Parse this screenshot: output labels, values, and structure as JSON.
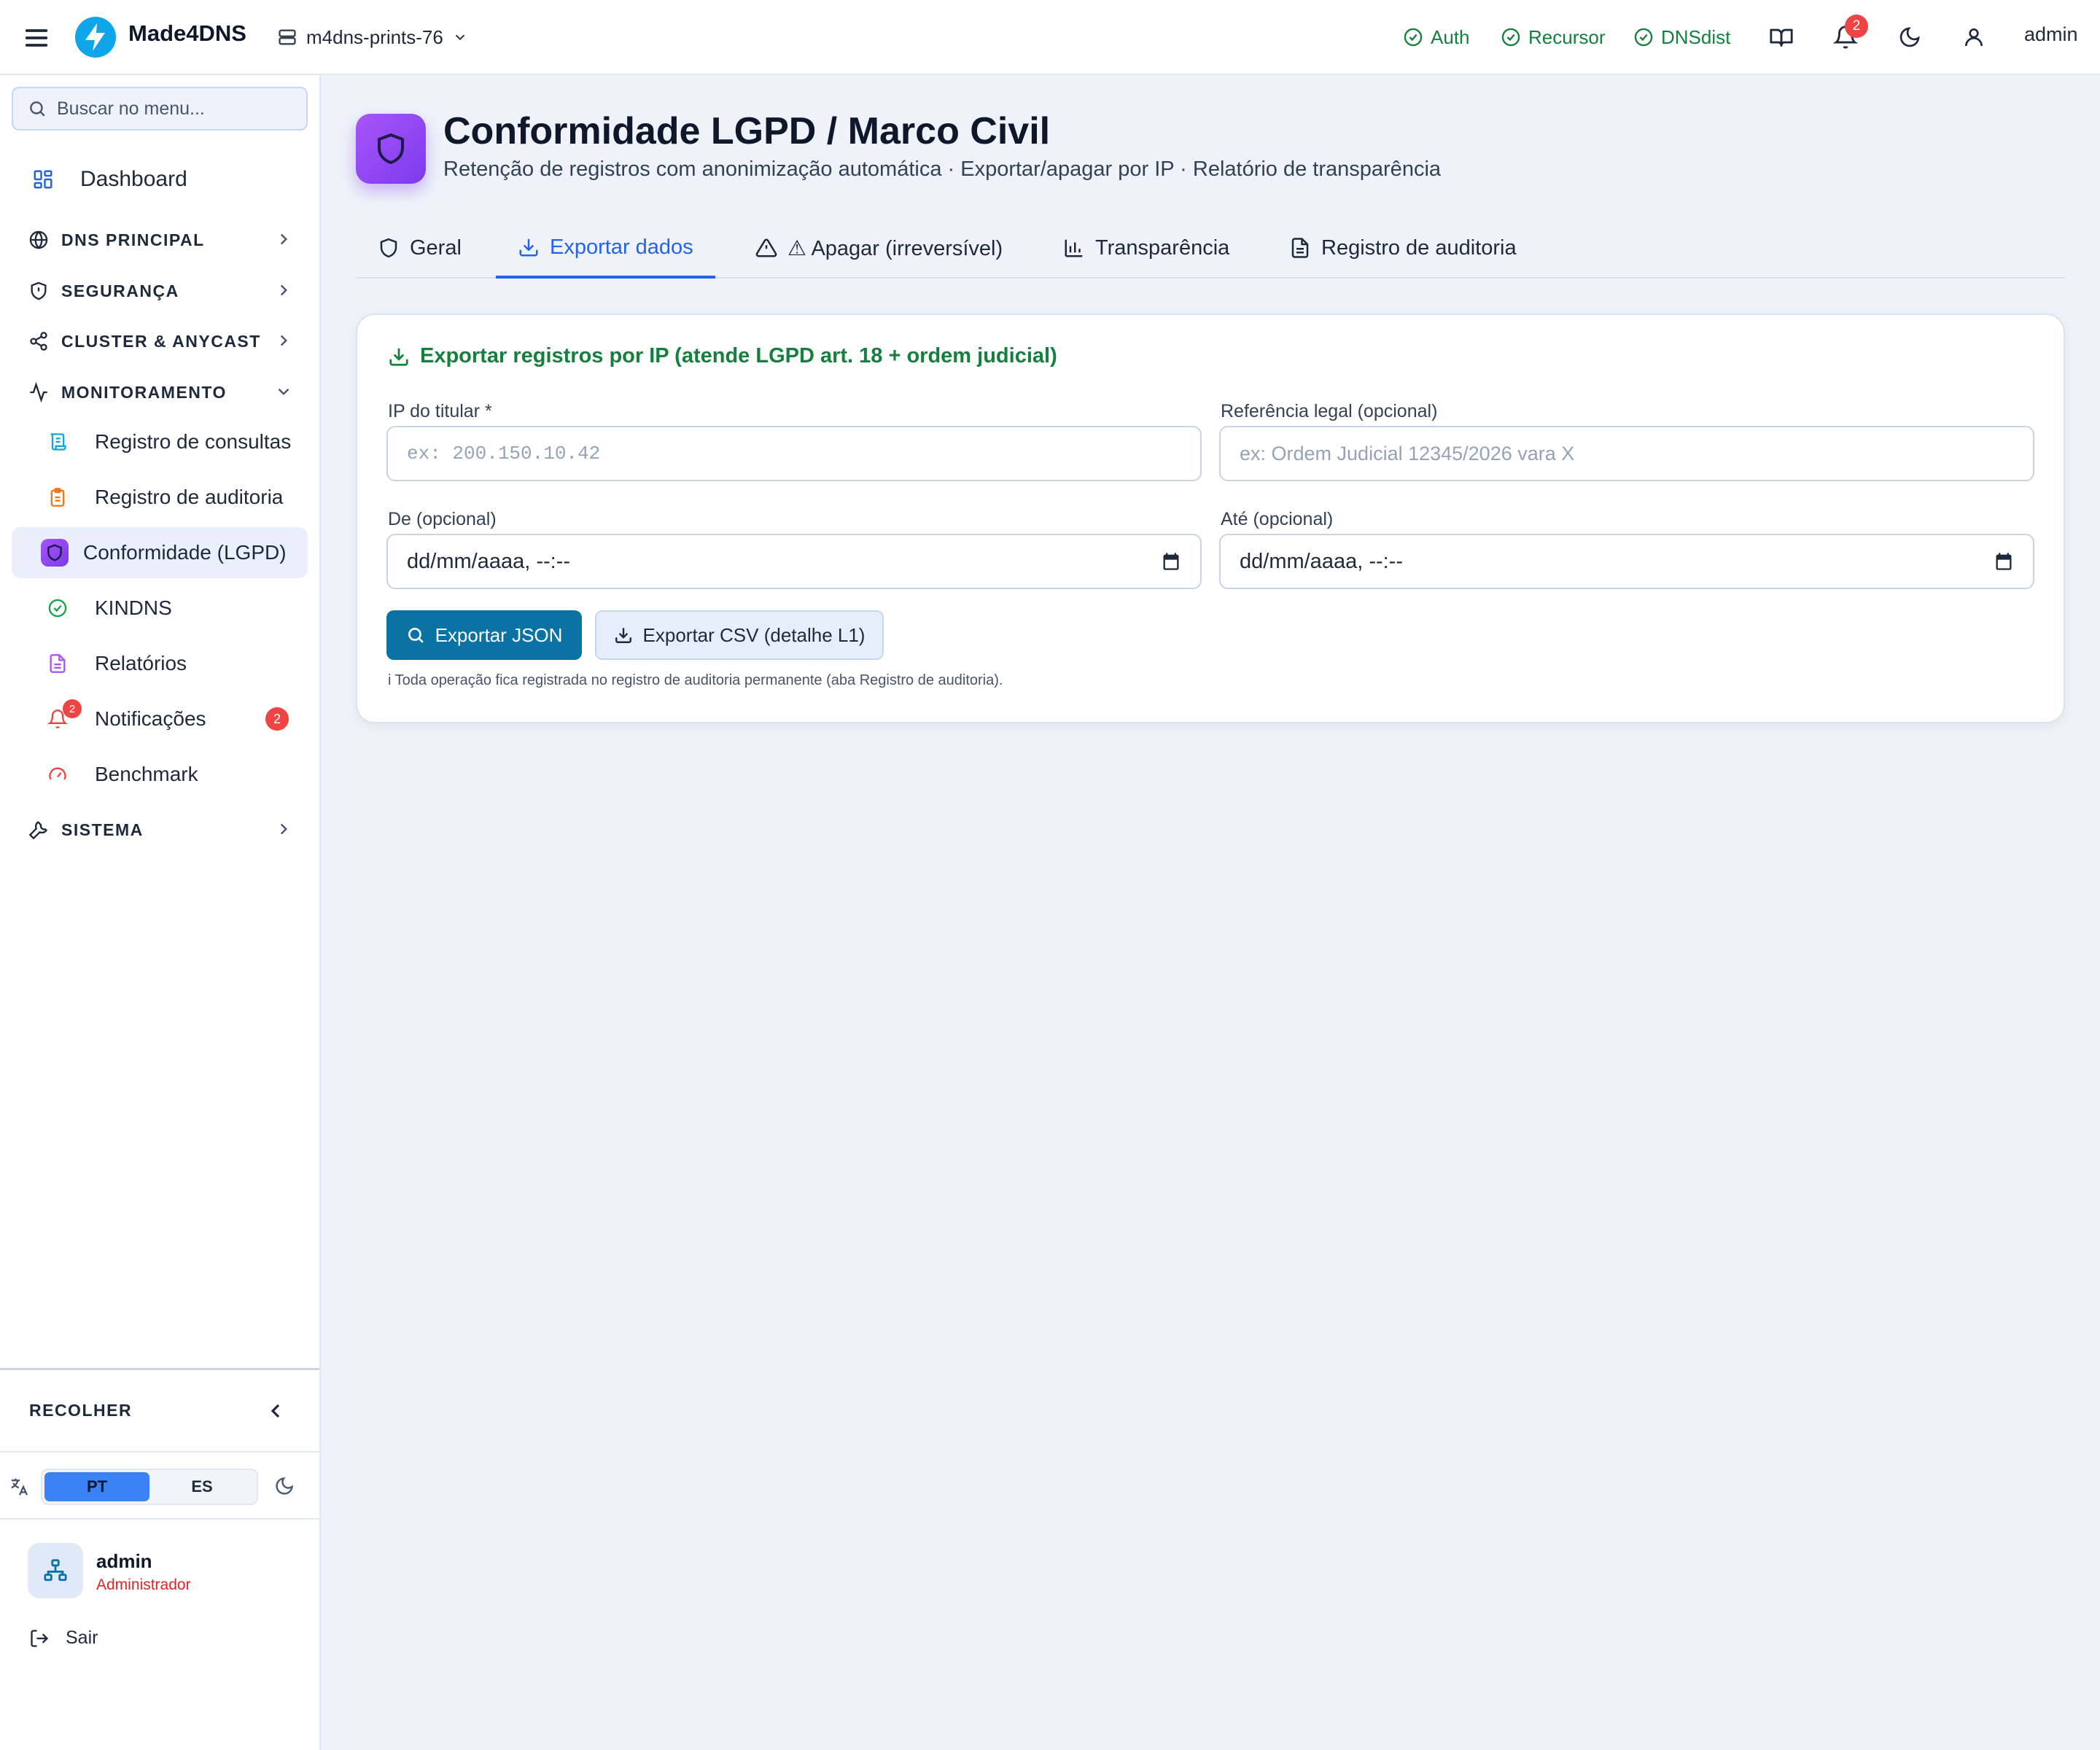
{
  "topbar": {
    "brand": "Made4DNS",
    "server": "m4dns-prints-76",
    "status": [
      {
        "label": "Auth",
        "color": "#15803d"
      },
      {
        "label": "Recursor",
        "color": "#15803d"
      },
      {
        "label": "DNSdist",
        "color": "#15803d"
      }
    ],
    "notification_count": "2",
    "user": "admin"
  },
  "sidebar": {
    "search_placeholder": "Buscar no menu...",
    "dashboard": "Dashboard",
    "sections": {
      "dns": "DNS PRINCIPAL",
      "security": "SEGURANÇA",
      "cluster": "CLUSTER & ANYCAST",
      "monitoring": "MONITORAMENTO",
      "system": "SISTEMA"
    },
    "monitoring_items": [
      {
        "label": "Registro de consultas",
        "icon": "scroll-icon"
      },
      {
        "label": "Registro de auditoria",
        "icon": "clipboard-icon"
      },
      {
        "label": "Conformidade (LGPD)",
        "icon": "shield-icon",
        "active": true
      },
      {
        "label": "KINDNS",
        "icon": "check-circle-icon"
      },
      {
        "label": "Relatórios",
        "icon": "file-text-icon"
      },
      {
        "label": "Notificações",
        "icon": "bell-icon",
        "badge": "2"
      },
      {
        "label": "Benchmark",
        "icon": "gauge-icon"
      }
    ],
    "collapse": "RECOLHER",
    "languages": [
      "PT",
      "ES"
    ],
    "selected_language": "PT",
    "user_name": "admin",
    "user_role": "Administrador",
    "logout": "Sair"
  },
  "page": {
    "title": "Conformidade LGPD / Marco Civil",
    "subtitle": "Retenção de registros com anonimização automática · Exportar/apagar por IP · Relatório de transparência",
    "tabs": [
      {
        "label": "Geral",
        "icon": "shield-icon"
      },
      {
        "label": "Exportar dados",
        "icon": "download-icon",
        "active": true
      },
      {
        "label": "⚠ Apagar (irreversível)",
        "icon": "warning-icon"
      },
      {
        "label": "Transparência",
        "icon": "bar-chart-icon"
      },
      {
        "label": "Registro de auditoria",
        "icon": "file-text-icon"
      }
    ]
  },
  "export_card": {
    "title": "Exportar registros por IP (atende LGPD art. 18 + ordem judicial)",
    "ip_label": "IP do titular *",
    "ip_placeholder": "ex: 200.150.10.42",
    "ref_label": "Referência legal (opcional)",
    "ref_placeholder": "ex: Ordem Judicial 12345/2026 vara X",
    "from_label": "De (opcional)",
    "from_value": "dd/mm/aaaa, --:--",
    "to_label": "Até (opcional)",
    "to_value": "dd/mm/aaaa, --:--",
    "btn_json": "Exportar JSON",
    "btn_csv": "Exportar CSV (detalhe L1)",
    "hint": "i Toda operação fica registrada no registro de auditoria permanente (aba Registro de auditoria)."
  },
  "colors": {
    "accent": "#2563eb",
    "success": "#15803d",
    "primary_button": "#0b73a3",
    "badge": "#ef4444",
    "brand_purple": "#7c3aed"
  }
}
